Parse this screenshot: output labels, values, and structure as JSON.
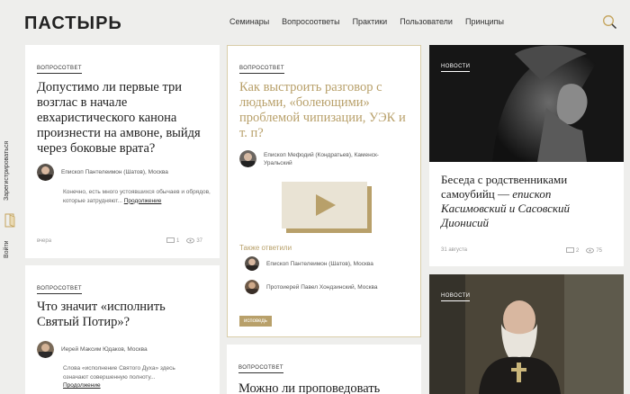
{
  "header": {
    "logo": "ПАСТЫРЬ",
    "nav": [
      "Семинары",
      "Вопросоответы",
      "Практики",
      "Пользователи",
      "Принципы"
    ]
  },
  "side": {
    "register": "Зарегистрироваться",
    "login": "Войти"
  },
  "cards": {
    "c1": {
      "tag": "вопросответ",
      "title": "Допустимо ли первые три возглас в начале евхаристического канона произнести на амвоне, выйдя через боковые врата?",
      "author": "Епископ Пантелеимон (Шатов), Москва",
      "excerpt": "Конечно, есть много устоявшихся обычаев и обрядов, которые затрудняют...",
      "more": "Продолжение",
      "date": "вчера",
      "comments": "1",
      "views": "37"
    },
    "c2": {
      "tag": "вопросответ",
      "title": "Что значит «исполнить Святый Потир»?",
      "author": "Иерей Максим Юдаков, Москва",
      "excerpt": "Слова «исполнение Святого Духа» здесь означают совершенную полноту...",
      "more": "Продолжение"
    },
    "c3": {
      "tag": "вопросответ",
      "title": "Как выстроить разговор с людьми, «болеющими» проблемой чипизации, УЭК и т. п?",
      "author1": "Епископ Мефодий (Кондратьев), Каменск-Уральский",
      "also": "Также ответили",
      "author2": "Епископ Пантелеимон (Шатов), Москва",
      "author3": "Протоиерей Павел Хондзинский, Москва",
      "badge": "исповедь"
    },
    "c4": {
      "tag": "вопросответ",
      "title": "Можно ли проповедовать"
    },
    "n1": {
      "tag": "новости",
      "title": "Беседа с родственниками самоубийц — ",
      "title_italic": "епископ Касимовский и Сасовский Дионисий",
      "date": "31 августа",
      "comments": "2",
      "views": "75"
    },
    "n2": {
      "tag": "новости"
    }
  }
}
